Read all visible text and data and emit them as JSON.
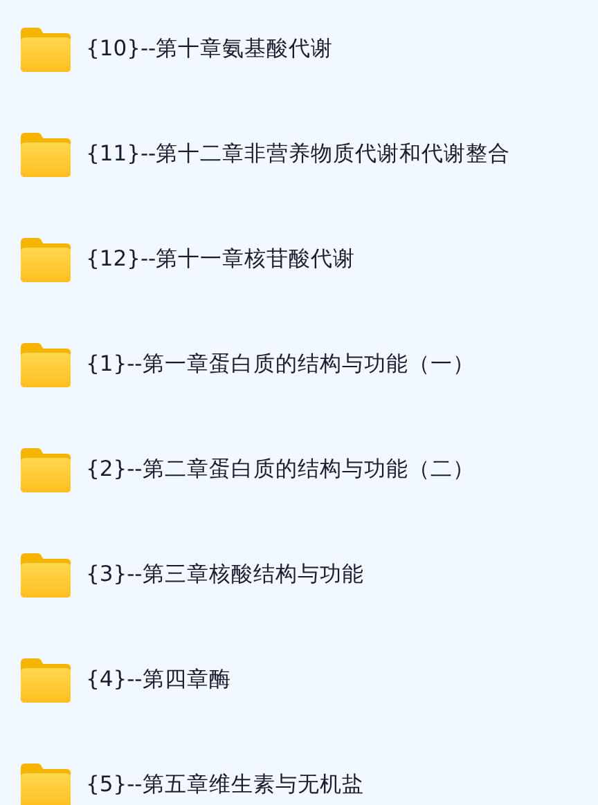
{
  "folders": [
    {
      "name": "{10}--第十章氨基酸代谢"
    },
    {
      "name": "{11}--第十二章非营养物质代谢和代谢整合"
    },
    {
      "name": "{12}--第十一章核苷酸代谢"
    },
    {
      "name": "{1}--第一章蛋白质的结构与功能（一）"
    },
    {
      "name": "{2}--第二章蛋白质的结构与功能（二）"
    },
    {
      "name": "{3}--第三章核酸结构与功能"
    },
    {
      "name": "{4}--第四章酶"
    },
    {
      "name": "{5}--第五章维生素与无机盐"
    }
  ]
}
